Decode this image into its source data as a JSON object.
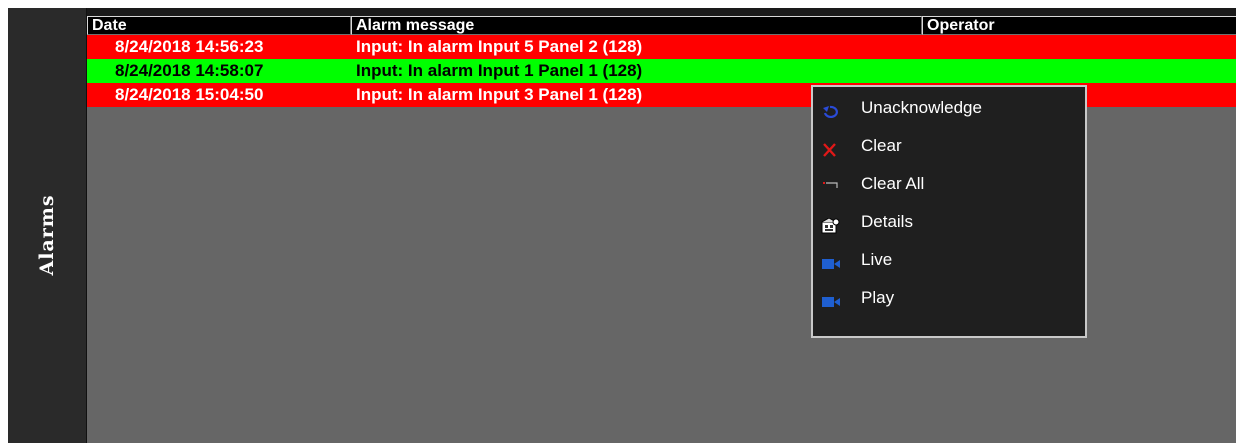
{
  "sidebar": {
    "label": "Alarms"
  },
  "table": {
    "columns": [
      "Date",
      "Alarm message",
      "Operator"
    ],
    "rows": [
      {
        "date": "8/24/2018 14:56:23",
        "message": "Input: In alarm Input 5  Panel 2 (128)",
        "operator": "",
        "status": "red"
      },
      {
        "date": "8/24/2018 14:58:07",
        "message": "Input: In alarm Input 1  Panel 1 (128)",
        "operator": "",
        "status": "green"
      },
      {
        "date": "8/24/2018 15:04:50",
        "message": "Input: In alarm Input 3  Panel 1 (128)",
        "operator": "",
        "status": "red"
      }
    ]
  },
  "context_menu": {
    "items": [
      {
        "label": "Unacknowledge",
        "icon": "unacknowledge-icon"
      },
      {
        "label": "Clear",
        "icon": "clear-icon"
      },
      {
        "label": "Clear All",
        "icon": "clear-all-icon"
      },
      {
        "label": "Details",
        "icon": "details-icon"
      },
      {
        "label": "Live",
        "icon": "camera-icon"
      },
      {
        "label": "Play",
        "icon": "camera-icon"
      }
    ]
  },
  "colors": {
    "alarm_red": "#ff0000",
    "alarm_green": "#00ff00",
    "panel_gray": "#666666",
    "camera_blue": "#1f5fd0"
  }
}
